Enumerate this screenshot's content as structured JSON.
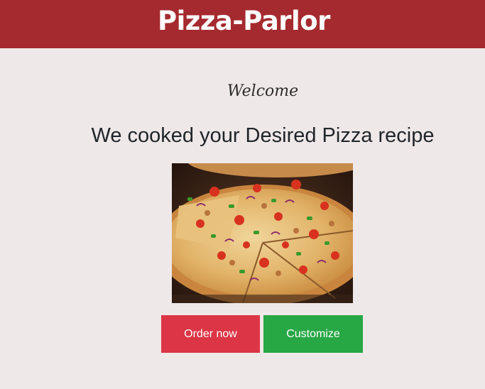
{
  "header": {
    "brand": "Pizza-Parlor",
    "background_color": "#a52a2f"
  },
  "main": {
    "welcome": "Welcome",
    "headline": "We cooked your Desired Pizza recipe",
    "image": {
      "alt": "Pizza with vegetables and cheese",
      "icon": "pizza-photo"
    },
    "buttons": {
      "order_label": "Order now",
      "order_color": "#dc3545",
      "customize_label": "Customize",
      "customize_color": "#28a745"
    }
  }
}
